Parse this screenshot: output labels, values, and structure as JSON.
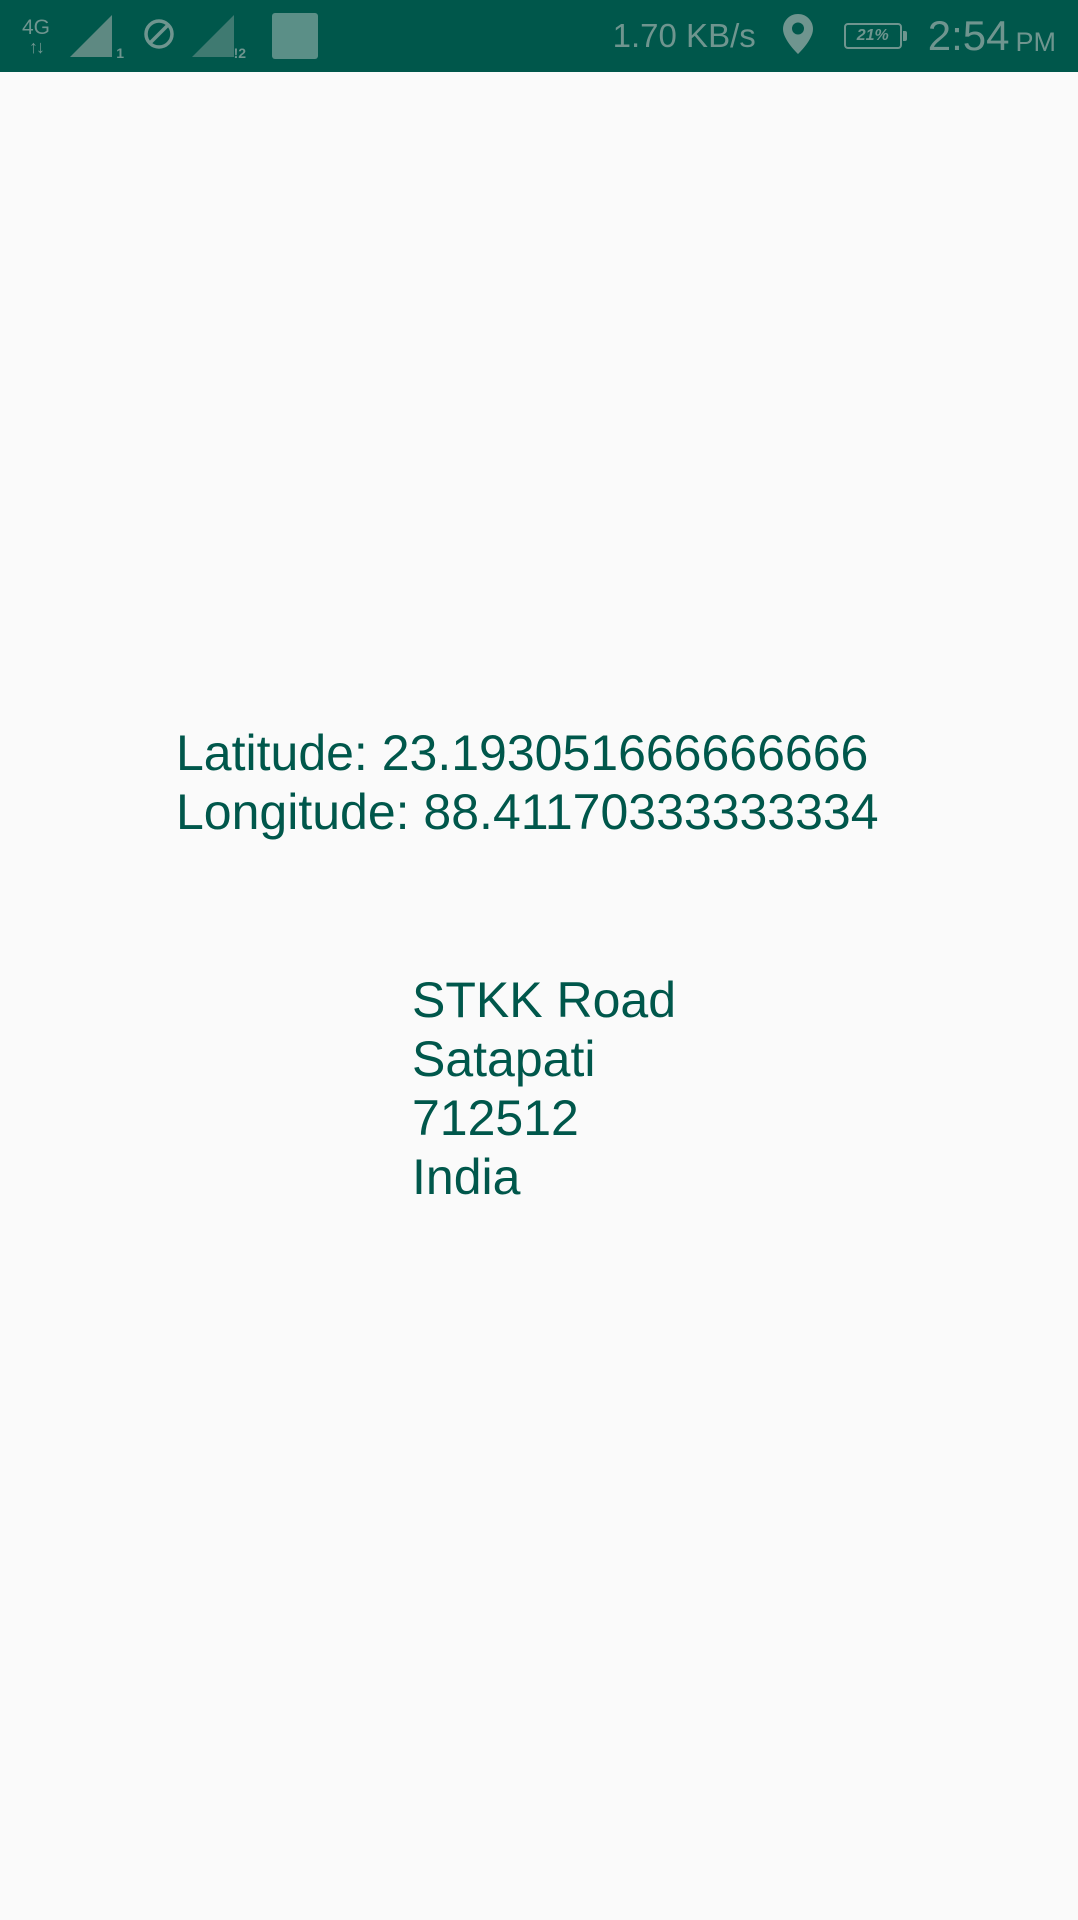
{
  "status_bar": {
    "network_type": "4G",
    "network_arrows": "↑↓",
    "sim1_label": "1",
    "sim2_label": "!2",
    "data_speed": "1.70 KB/s",
    "battery": "21%",
    "time": "2:54",
    "ampm": "PM",
    "icons": [
      "network-4g-icon",
      "signal-icon",
      "do-not-disturb-icon",
      "signal-icon",
      "sim-icon",
      "location-icon",
      "battery-icon"
    ]
  },
  "location": {
    "latitude_line": "Latitude: 23.193051666666666",
    "longitude_line": "Longitude: 88.41170333333334"
  },
  "address": {
    "lines": [
      "STKK Road",
      "Satapati",
      "712512",
      "India"
    ]
  },
  "colors": {
    "primary_dark": "#00574b",
    "text": "#00574b",
    "background": "#fafafa",
    "status_icons": "#6f958f"
  }
}
